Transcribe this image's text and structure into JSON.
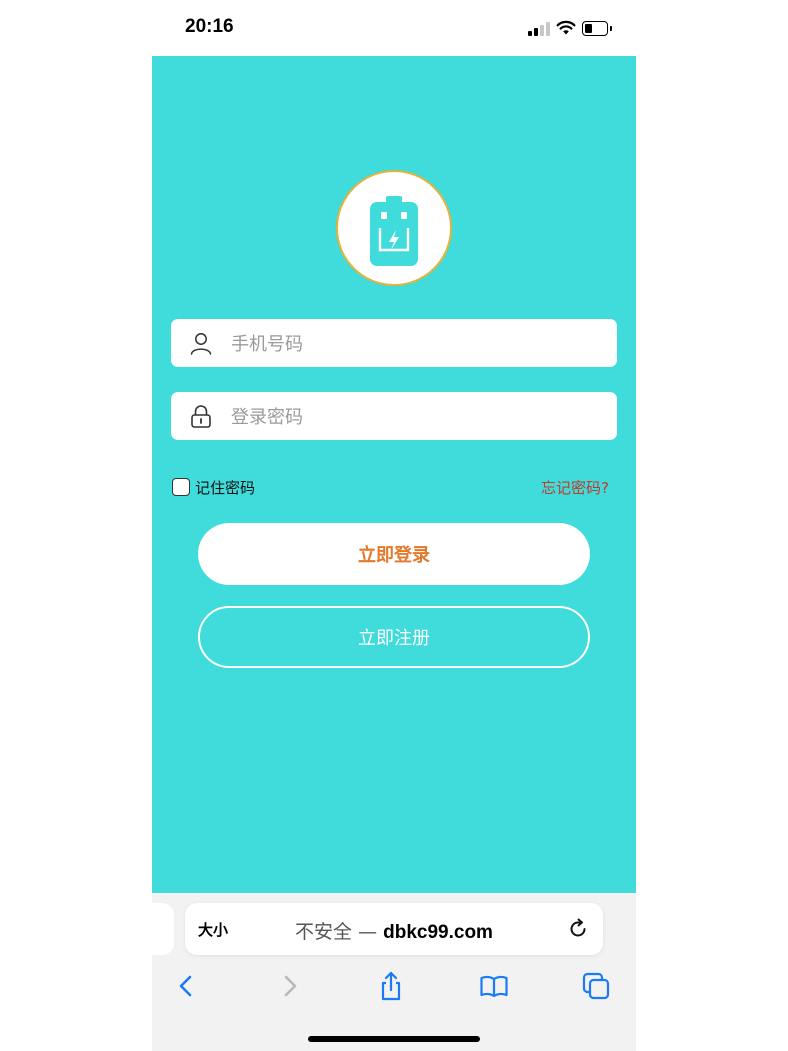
{
  "status_bar": {
    "time": "20:16"
  },
  "login": {
    "phone_placeholder": "手机号码",
    "password_placeholder": "登录密码",
    "remember_label": "记住密码",
    "remember_checked": false,
    "forgot_label": "忘记密码?",
    "login_button": "立即登录",
    "register_button": "立即注册"
  },
  "browser": {
    "text_size_label": "大小",
    "url_prefix": "不安全 — ",
    "url_domain": "dbkc99.com"
  },
  "icons": {
    "logo": "battery-icon",
    "phone_field": "user-icon",
    "password_field": "lock-icon",
    "reload": "reload-icon",
    "back": "chevron-left-icon",
    "forward": "chevron-right-icon",
    "share": "share-icon",
    "bookmarks": "book-icon",
    "tabs": "tabs-icon"
  },
  "colors": {
    "background": "#40dbdb",
    "login_text": "#e2792b",
    "forgot_text": "#c0392b",
    "logo_border": "#e5b23a",
    "toolbar_active": "#1a7cf5"
  }
}
